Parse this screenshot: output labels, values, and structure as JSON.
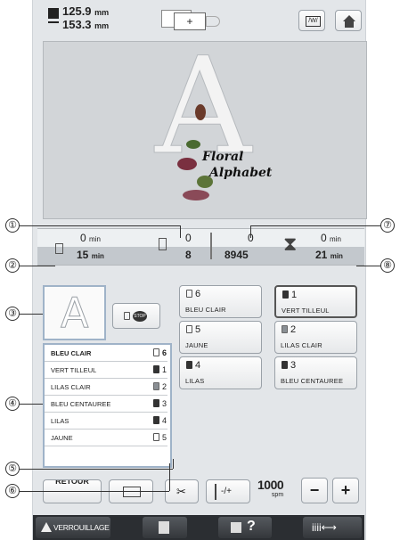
{
  "header": {
    "width_value": "125.9",
    "height_value": "153.3",
    "unit": "mm",
    "frame_icon": "hoop-frame-icon",
    "hoop_icon": "hoop-icon",
    "home_icon": "home-icon"
  },
  "preview": {
    "letter": "A",
    "caption_line1": "Floral",
    "caption_line2": "Alphabet"
  },
  "stats": {
    "top_left_min_value": "0",
    "top_left_min_unit": "min",
    "bottom_left_min_value": "15",
    "bottom_left_min_unit": "min",
    "color_count_top": "0",
    "color_count_bottom": "8",
    "stitch_top": "0",
    "stitch_bottom": "8945",
    "time_top_value": "0",
    "time_top_unit": "min",
    "time_bottom_value": "21",
    "time_bottom_unit": "min"
  },
  "callouts": [
    "①",
    "②",
    "③",
    "④",
    "⑤",
    "⑥",
    "⑦",
    "⑧"
  ],
  "stop_button_label": "STOP",
  "color_boxes": [
    {
      "num": "6",
      "name": "BLEU CLAIR",
      "spool": "outline"
    },
    {
      "num": "1",
      "name": "VERT TILLEUL",
      "spool": "filled"
    },
    {
      "num": "5",
      "name": "JAUNE",
      "spool": "outline"
    },
    {
      "num": "2",
      "name": "LILAS CLAIR",
      "spool": "gray"
    },
    {
      "num": "4",
      "name": "LILAS",
      "spool": "filled"
    },
    {
      "num": "3",
      "name": "BLEU CENTAUREE",
      "spool": "filled"
    }
  ],
  "sequence_list": [
    {
      "name": "BLEU CLAIR",
      "no": "6"
    },
    {
      "name": "VERT TILLEUL",
      "no": "1"
    },
    {
      "name": "LILAS CLAIR",
      "no": "2"
    },
    {
      "name": "BLEU CENTAUREE",
      "no": "3"
    },
    {
      "name": "LILAS",
      "no": "4"
    },
    {
      "name": "JAUNE",
      "no": "5"
    }
  ],
  "bottom": {
    "return_label": "RETOUR",
    "speed_value": "1000",
    "speed_unit": "spm",
    "minus": "−",
    "plus": "+",
    "needle_label": "-/+"
  },
  "footer": {
    "lock_label": "VERROUILLAGE",
    "help_label": "?"
  }
}
